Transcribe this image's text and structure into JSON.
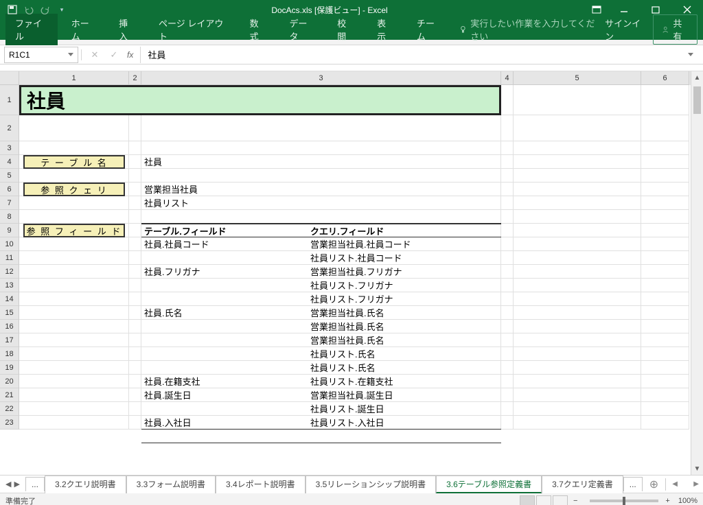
{
  "title": "DocAcs.xls  [保護ビュー] - Excel",
  "ribbon": {
    "file": "ファイル",
    "tabs": [
      "ホーム",
      "挿入",
      "ページ レイアウト",
      "数式",
      "データ",
      "校閲",
      "表示",
      "チーム"
    ],
    "tellme": "実行したい作業を入力してください",
    "signin": "サインイン",
    "share": "共有"
  },
  "namebox": "R1C1",
  "formula": "社員",
  "columns": [
    "1",
    "2",
    "3",
    "4",
    "5",
    "6"
  ],
  "rows": [
    "1",
    "2",
    "3",
    "4",
    "5",
    "6",
    "7",
    "8",
    "9",
    "10",
    "11",
    "12",
    "13",
    "14",
    "15",
    "16",
    "17",
    "18",
    "19",
    "20",
    "21",
    "22",
    "23"
  ],
  "bigTitle": "社員",
  "labels": {
    "table_name": "テ ー ブ ル 名",
    "ref_query": "参 照 ク ェ リ",
    "ref_field": "参 照 フ ィ ー ル ド"
  },
  "values": {
    "table_name_val": "社員",
    "ref_query_val1": "営業担当社員",
    "ref_query_val2": "社員リスト",
    "hdr_table_field": "テーブル.フィールド",
    "hdr_query_field": "クエリ.フィールド"
  },
  "fields": [
    {
      "t": "社員.社員コード",
      "q": "営業担当社員.社員コード"
    },
    {
      "t": "",
      "q": "社員リスト.社員コード"
    },
    {
      "t": "社員.フリガナ",
      "q": "営業担当社員.フリガナ"
    },
    {
      "t": "",
      "q": "社員リスト.フリガナ"
    },
    {
      "t": "",
      "q": "社員リスト.フリガナ"
    },
    {
      "t": "社員.氏名",
      "q": "営業担当社員.氏名"
    },
    {
      "t": "",
      "q": "営業担当社員.氏名"
    },
    {
      "t": "",
      "q": "営業担当社員.氏名"
    },
    {
      "t": "",
      "q": "社員リスト.氏名"
    },
    {
      "t": "",
      "q": "社員リスト.氏名"
    },
    {
      "t": "社員.在籍支社",
      "q": "社員リスト.在籍支社"
    },
    {
      "t": "社員.誕生日",
      "q": "営業担当社員.誕生日"
    },
    {
      "t": "",
      "q": "社員リスト.誕生日"
    },
    {
      "t": "社員.入社日",
      "q": "社員リスト.入社日"
    }
  ],
  "sheetTabs": {
    "ellipsis": "...",
    "tabs": [
      "3.2クエリ説明書",
      "3.3フォーム説明書",
      "3.4レポート説明書",
      "3.5リレーションシップ説明書",
      "3.6テーブル参照定義書",
      "3.7クエリ定義書"
    ],
    "active": 4
  },
  "status": {
    "ready": "準備完了",
    "zoom": "100%"
  }
}
